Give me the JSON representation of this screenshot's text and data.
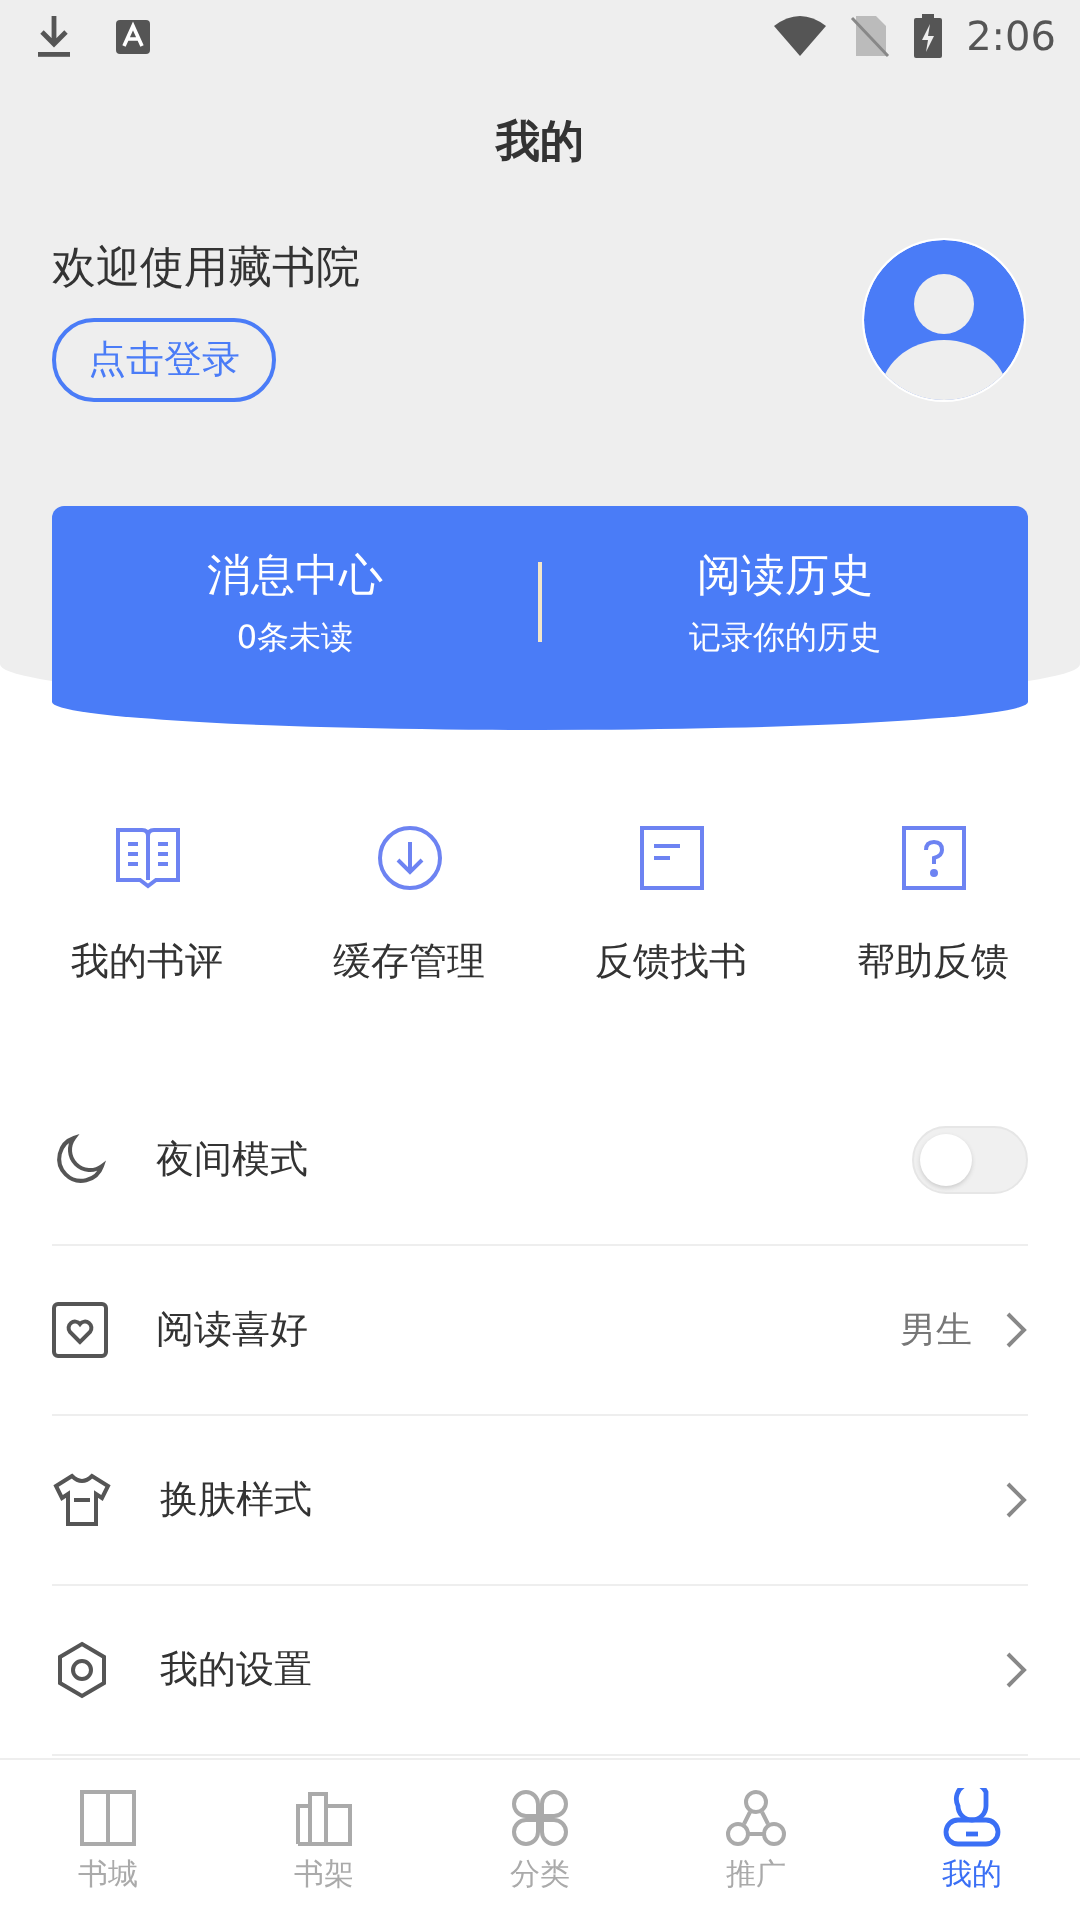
{
  "status_bar": {
    "time": "2:06"
  },
  "title": "我的",
  "profile": {
    "welcome": "欢迎使用藏书院",
    "login_button": "点击登录"
  },
  "summary_card": [
    {
      "title": "消息中心",
      "subtitle": "0条未读"
    },
    {
      "title": "阅读历史",
      "subtitle": "记录你的历史"
    }
  ],
  "shortcuts": [
    {
      "kind": "book",
      "label": "我的书评"
    },
    {
      "kind": "download",
      "label": "缓存管理"
    },
    {
      "kind": "note",
      "label": "反馈找书"
    },
    {
      "kind": "help",
      "label": "帮助反馈"
    }
  ],
  "settings": [
    {
      "kind": "toggle",
      "label": "夜间模式",
      "on": false
    },
    {
      "kind": "link",
      "label": "阅读喜好",
      "value": "男生"
    },
    {
      "kind": "link",
      "label": "换肤样式"
    },
    {
      "kind": "link",
      "label": "我的设置"
    }
  ],
  "bottom_nav": [
    {
      "label": "书城",
      "selected": false
    },
    {
      "label": "书架",
      "selected": false
    },
    {
      "label": "分类",
      "selected": false
    },
    {
      "label": "推广",
      "selected": false
    },
    {
      "label": "我的",
      "selected": true
    }
  ]
}
